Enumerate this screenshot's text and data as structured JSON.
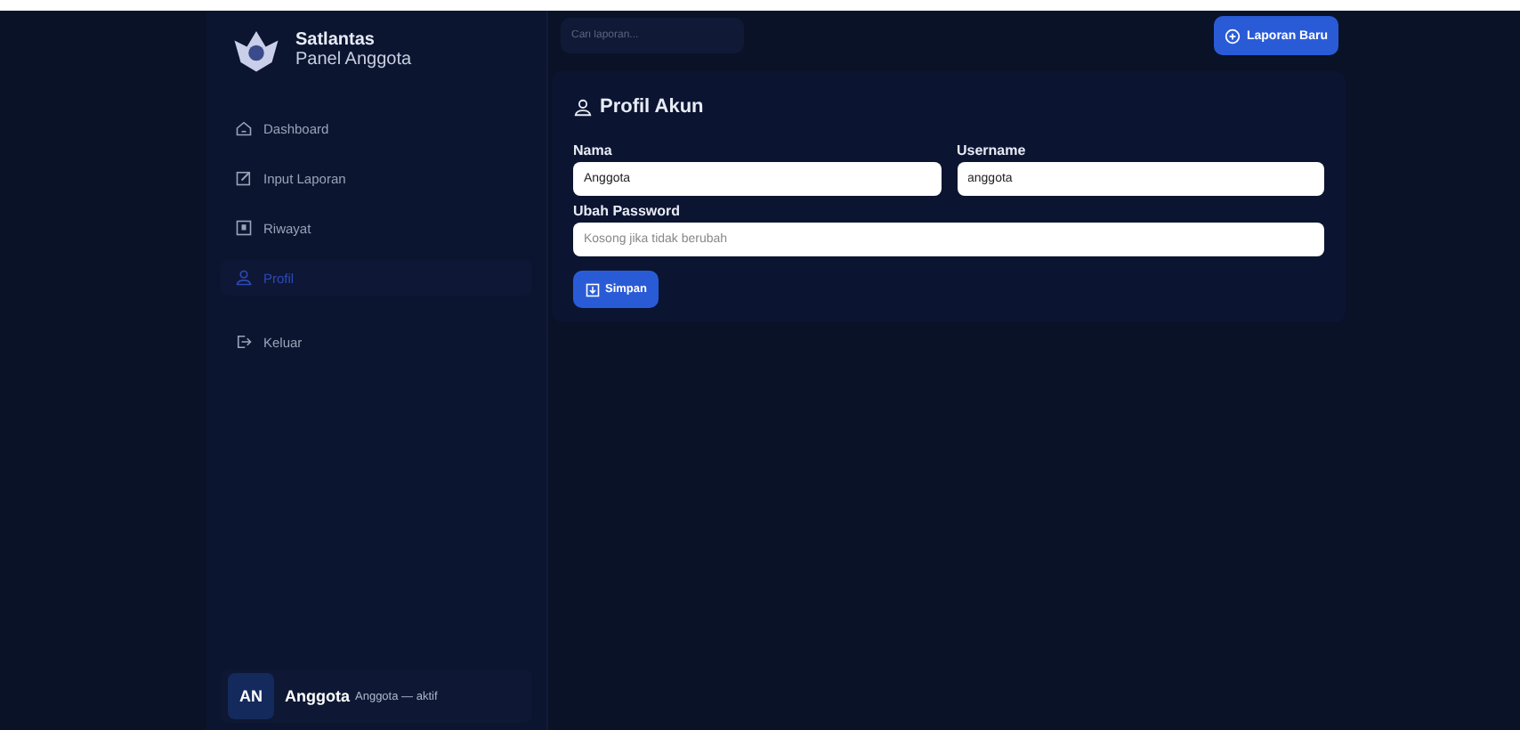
{
  "sidebar": {
    "brand": {
      "title": "Satlantas",
      "subtitle": "Panel Anggota"
    },
    "items": [
      {
        "label": "Dashboard",
        "selected": false
      },
      {
        "label": "Input Laporan",
        "selected": false
      },
      {
        "label": "Riwayat",
        "selected": false
      },
      {
        "label": "Profil",
        "selected": true
      },
      {
        "label": "Keluar",
        "selected": false
      }
    ],
    "user": {
      "initials": "AN",
      "name": "Anggota",
      "detail": "Anggota — aktif"
    }
  },
  "topbar": {
    "search": {
      "placeholder": "Cari laporan..."
    },
    "new_button": "Laporan Baru"
  },
  "profile": {
    "title": "Profil Akun",
    "fields": [
      {
        "label": "Nama",
        "value": "Anggota"
      },
      {
        "label": "Username",
        "value": "anggota"
      },
      {
        "label": "Ubah Password",
        "placeholder": "Kosong jika tidak berubah"
      }
    ],
    "save_button": "Simpan"
  }
}
